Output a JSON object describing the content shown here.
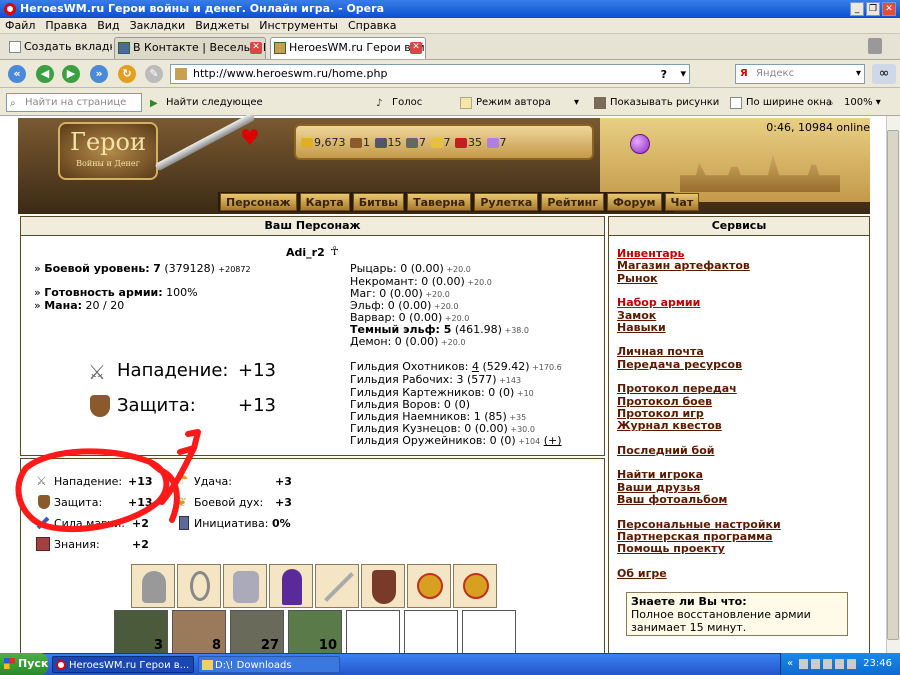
{
  "window": {
    "title": "HeroesWM.ru Герои войны и денег. Онлайн игра. - Opera"
  },
  "menu": [
    "Файл",
    "Правка",
    "Вид",
    "Закладки",
    "Виджеты",
    "Инструменты",
    "Справка"
  ],
  "tabs": {
    "new_tab": "Создать вкладку",
    "tab1": "В Контакте | Веселый Р...",
    "tab2": "HeroesWM.ru Герои вой..."
  },
  "address": {
    "url": "http://www.heroeswm.ru/home.php",
    "search_placeholder": "Яндекс"
  },
  "findbar": {
    "placeholder": "Найти на странице",
    "find_next": "Найти следующее",
    "voice": "Голос",
    "author_mode": "Режим автора",
    "show_images": "Показывать рисунки",
    "fit_width": "По ширине окна",
    "zoom": "100%"
  },
  "game": {
    "logo_main": "Герои",
    "logo_sub": "Войны и Денег",
    "online": "0:46, 10984 online",
    "resources": [
      {
        "value": "9,673",
        "color": "#e0b020"
      },
      {
        "value": "1",
        "color": "#8a5a2a"
      },
      {
        "value": "15",
        "color": "#556"
      },
      {
        "value": "7",
        "color": "#666"
      },
      {
        "value": "7",
        "color": "#e8c040"
      },
      {
        "value": "35",
        "color": "#c02020"
      },
      {
        "value": "7",
        "color": "#b080e0"
      }
    ],
    "nav": [
      "Персонаж",
      "Карта",
      "Битвы",
      "Таверна",
      "Рулетка",
      "Рейтинг",
      "Форум",
      "Чат"
    ]
  },
  "character": {
    "panel_title": "Ваш Персонаж",
    "name": "Adi_r2",
    "level_label": "Боевой уровень:",
    "level_value": "7",
    "level_exp": "(379128)",
    "level_next": "+20872",
    "ready_label": "Готовность армии:",
    "ready_value": "100%",
    "mana_label": "Мана:",
    "mana_value": "20 / 20",
    "attack_label": "Нападение:",
    "attack_value": "+13",
    "defense_label": "Защита:",
    "defense_value": "+13",
    "factions": [
      {
        "name": "Рыцарь: 0 (0.00)",
        "bonus": "+20.0"
      },
      {
        "name": "Некромант: 0 (0.00)",
        "bonus": "+20.0"
      },
      {
        "name": "Маг: 0 (0.00)",
        "bonus": "+20.0"
      },
      {
        "name": "Эльф: 0 (0.00)",
        "bonus": "+20.0"
      },
      {
        "name": "Варвар: 0 (0.00)",
        "bonus": "+20.0"
      },
      {
        "name": "Темный эльф: 5",
        "extra": "(461.98)",
        "bonus": "+38.0"
      },
      {
        "name": "Демон: 0 (0.00)",
        "bonus": "+20.0"
      }
    ],
    "guilds": [
      {
        "name": "Гильдия Охотников:",
        "value": "4",
        "extra": "(529.42)",
        "bonus": "+170.6"
      },
      {
        "name": "Гильдия Рабочих: 3 (577)",
        "bonus": "+143"
      },
      {
        "name": "Гильдия Картежников: 0 (0)",
        "bonus": "+10"
      },
      {
        "name": "Гильдия Воров: 0 (0)",
        "bonus": ""
      },
      {
        "name": "Гильдия Наемников: 1 (85)",
        "bonus": "+35"
      },
      {
        "name": "Гильдия Кузнецов: 0 (0.00)",
        "bonus": "+30.0"
      },
      {
        "name": "Гильдия Оружейников: 0 (0)",
        "bonus": "+104",
        "plus": "(+)"
      }
    ]
  },
  "stats": [
    {
      "label": "Нападение:",
      "value": "+13"
    },
    {
      "label": "Защита:",
      "value": "+13"
    },
    {
      "label": "Сила магии:",
      "value": "+2"
    },
    {
      "label": "Знания:",
      "value": "+2"
    },
    {
      "label": "Удача:",
      "value": "+3"
    },
    {
      "label": "Боевой дух:",
      "value": "+3"
    },
    {
      "label": "Инициатива:",
      "value": "0%"
    }
  ],
  "creatures": [
    "3",
    "8",
    "27",
    "10"
  ],
  "services": {
    "title": "Сервисы",
    "groups": [
      [
        "Инвентарь",
        "Магазин артефактов",
        "Рынок"
      ],
      [
        "Набор армии",
        "Замок",
        "Навыки"
      ],
      [
        "Личная почта",
        "Передача ресурсов"
      ],
      [
        "Протокол передач",
        "Протокол боев",
        "Протокол игр",
        "Журнал квестов"
      ],
      [
        "Последний бой"
      ],
      [
        "Найти игрока",
        "Ваши друзья",
        "Ваш фотоальбом"
      ],
      [
        "Персональные настройки",
        "Партнерская программа",
        "Помощь проекту"
      ],
      [
        "Об игре"
      ]
    ],
    "tip_title": "Знаете ли Вы что:",
    "tip_line1": "Полное восстановление армии",
    "tip_line2": "занимает 15 минут."
  },
  "taskbar": {
    "start": "Пуск",
    "task1": "HeroesWM.ru Герои в...",
    "task2": "D:\\! Downloads",
    "clock": "23:46"
  },
  "annotation_color": "#ff1a1a"
}
